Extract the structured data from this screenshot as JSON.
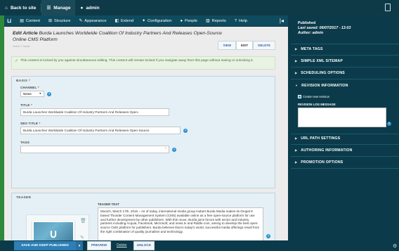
{
  "toolbar": {
    "back": "Back to site",
    "manage": "Manage",
    "user": "admin"
  },
  "menu": {
    "items": [
      "Content",
      "Structure",
      "Appearance",
      "Extend",
      "Configuration",
      "People",
      "Reports",
      "Help"
    ]
  },
  "page": {
    "title_prefix": "Edit Article",
    "title": "Burda Launches Worldwide Coalition Of Industry Partners And Releases Open-Source Online CMS Platform",
    "tabs": [
      "VIEW",
      "EDIT",
      "DELETE"
    ]
  },
  "notice": "This content is locked by you against simultaneous editing. This content will remain locked if you navigate away from this page without saving or unlocking it.",
  "basis": {
    "heading": "BASIS",
    "channel_label": "CHANNEL",
    "channel_value": "News",
    "title_label": "TITLE",
    "title_value": "Burda Launches Worldwide Coalition Of Industry Partners And Releases Open-",
    "seo_label": "SEO TITLE",
    "seo_value": "Burda Launches Worldwide Coalition Of Industry Partners And Releases Open-Source",
    "tags_label": "TAGS"
  },
  "teaser": {
    "heading": "TEASER",
    "text_label": "TEASER TEXT",
    "text": "Munich, March 17th, 2016 – As of today, international media group Hubert Burda Media makes its Drupal 8 based Thunder Content Management System (CMS) available online as a free open-source platform for use and further development by other publishers. With this move, Burda joins forces with sector and industry partners including Acquia, Facebook, Microsoft, and news.tv and Riddle.com, aiming to develop the best open-source CMS platform for publishers. Burda believes that in today's world, successful media offerings result from the right combination of quality journalism and technology."
  },
  "actions": {
    "save": "SAVE AND KEEP PUBLISHED",
    "preview": "PREVIEW",
    "delete": "Delete",
    "unlock": "UNLOCK"
  },
  "sidebar": {
    "status": "Published",
    "last_saved_label": "Last saved:",
    "last_saved": "06/07/2017 - 13:03",
    "author_label": "Author:",
    "author": "admin",
    "sections": [
      "META TAGS",
      "SIMPLE XML SITEMAP",
      "SCHEDULING OPTIONS",
      "REVISION INFORMATION",
      "URL PATH SETTINGS",
      "AUTHORING INFORMATION",
      "PROMOTION OPTIONS"
    ],
    "create_revision": "Create new revision",
    "revision_log": "REVISION LOG MESSAGE"
  }
}
